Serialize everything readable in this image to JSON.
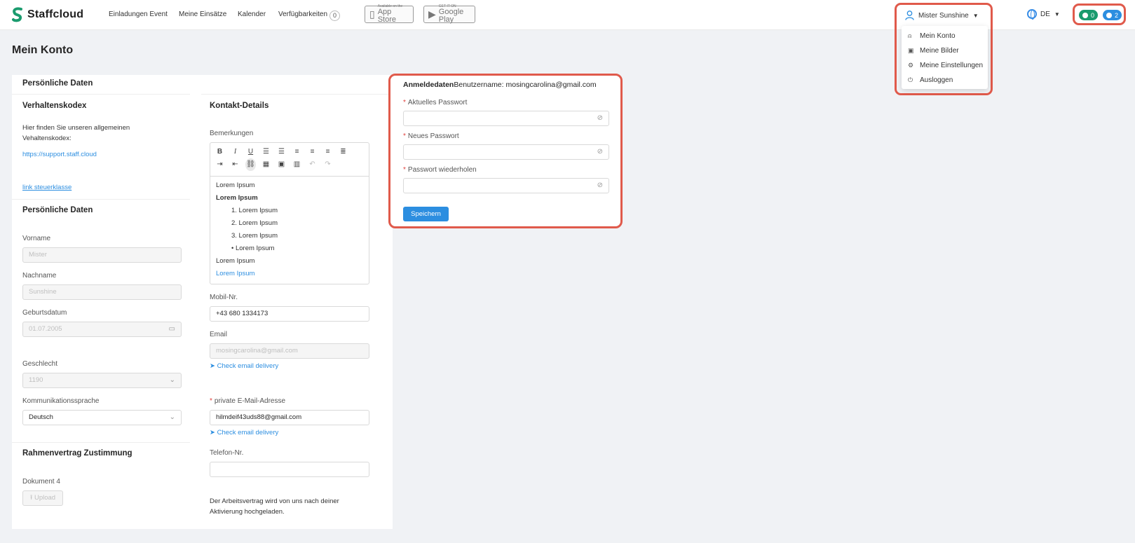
{
  "header": {
    "logo_text": "Staffcloud",
    "nav": [
      "Einladungen Event",
      "Meine Einsätze",
      "Kalender",
      "Verfügbarkeiten"
    ],
    "availability_count": "0",
    "app_store": {
      "small": "Available on the",
      "big": "App Store"
    },
    "google_play": {
      "small": "GET IT ON",
      "big": "Google Play"
    },
    "user_name": "Mister Sunshine",
    "user_menu": [
      {
        "label": "Mein Konto",
        "icon": "user-icon"
      },
      {
        "label": "Meine Bilder",
        "icon": "image-icon"
      },
      {
        "label": "Meine Einstellungen",
        "icon": "gear-icon"
      },
      {
        "label": "Ausloggen",
        "icon": "logout-icon"
      }
    ],
    "language": "DE",
    "messages_count": "0",
    "notifications_count": "2",
    "colors": {
      "accent": "#2c8ee0",
      "green": "#1a9b6e",
      "highlight": "#e05a4b"
    }
  },
  "page": {
    "title": "Mein Konto"
  },
  "left": {
    "section_personal_top": "Persönliche Daten",
    "conduct_title": "Verhaltenskodex",
    "conduct_text": "Hier finden Sie unseren allgemeinen Vehaltenskodex:",
    "conduct_link": "https://support.staff.cloud",
    "tax_link": "link steuerklasse",
    "personal_title": "Persönliche Daten",
    "first_name_label": "Vorname",
    "first_name": "Mister",
    "last_name_label": "Nachname",
    "last_name": "Sunshine",
    "birthdate_label": "Geburtsdatum",
    "birthdate": "01.07.2005",
    "gender_label": "Geschlecht",
    "gender": "1190",
    "comm_lang_label": "Kommunikationssprache",
    "comm_lang": "Deutsch",
    "contract_title": "Rahmenvertrag Zustimmung",
    "document_label": "Dokument 4",
    "upload_label": "Upload"
  },
  "contact": {
    "title": "Kontakt-Details",
    "remarks_label": "Bemerkungen",
    "editor_lines": [
      "Lorem Ipsum",
      "Lorem Ipsum",
      "1. Lorem Ipsum",
      "2. Lorem Ipsum",
      "3. Lorem Ipsum",
      "• Lorem Ipsum",
      "Lorem Ipsum",
      "Lorem Ipsum"
    ],
    "mobile_label": "Mobil-Nr.",
    "mobile": "+43 680 1334173",
    "email_label": "Email",
    "email": "mosingcarolina@gmail.com",
    "check_email": "Check email delivery",
    "private_email_label": "private E-Mail-Adresse",
    "private_email": "hilmdeif43uds88@gmail.com",
    "phone_label": "Telefon-Nr.",
    "phone": "",
    "contract_note": "Der Arbeitsvertrag wird von uns nach deiner Aktivierung hochgeladen."
  },
  "login": {
    "title": "Anmeldedaten",
    "username_prefix": "Benutzername: ",
    "username": "mosingcarolina@gmail.com",
    "current_pw_label": "Aktuelles Passwort",
    "new_pw_label": "Neues Passwort",
    "repeat_pw_label": "Passwort wiederholen",
    "save_label": "Speichern"
  }
}
